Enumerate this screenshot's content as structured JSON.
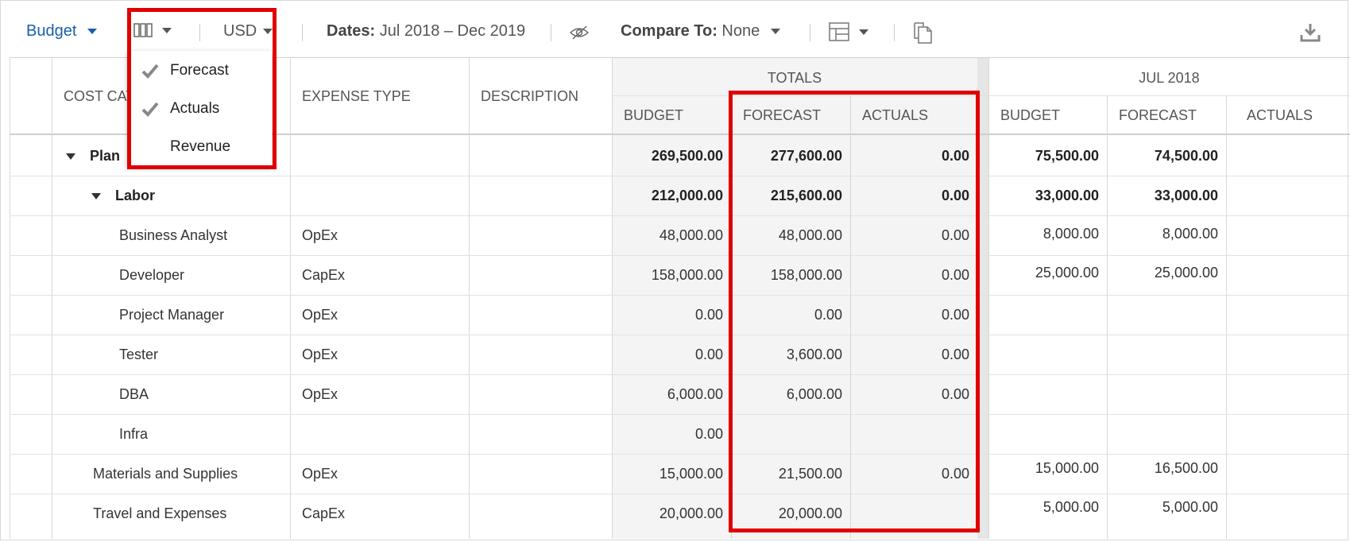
{
  "toolbar": {
    "view": "Budget",
    "currency": "USD",
    "dates_label": "Dates:",
    "dates_value": "Jul 2018 – Dec 2019",
    "compare_label": "Compare To:",
    "compare_value": "None",
    "icons": [
      "columns-icon",
      "visibility-icon",
      "table-layout-icon",
      "copy-icon",
      "download-icon"
    ]
  },
  "columns_menu": {
    "items": [
      {
        "label": "Forecast",
        "checked": true
      },
      {
        "label": "Actuals",
        "checked": true
      },
      {
        "label": "Revenue",
        "checked": false
      }
    ]
  },
  "headers": {
    "cost_category": "COST CAT",
    "expense_type": "EXPENSE TYPE",
    "description": "DESCRIPTION",
    "totals": "TOTALS",
    "jul2018": "JUL 2018",
    "budget": "BUDGET",
    "forecast": "FORECAST",
    "actuals": "ACTUALS"
  },
  "rows": [
    {
      "name": "Plan",
      "type": "",
      "t_budget": "269,500.00",
      "t_forecast": "277,600.00",
      "t_actuals": "0.00",
      "m_budget": "75,500.00",
      "m_forecast": "74,500.00"
    },
    {
      "name": "Labor",
      "type": "",
      "t_budget": "212,000.00",
      "t_forecast": "215,600.00",
      "t_actuals": "0.00",
      "m_budget": "33,000.00",
      "m_forecast": "33,000.00"
    },
    {
      "name": "Business Analyst",
      "type": "OpEx",
      "t_budget": "48,000.00",
      "t_forecast": "48,000.00",
      "t_actuals": "0.00",
      "m_budget": "8,000.00",
      "m_forecast": "8,000.00"
    },
    {
      "name": "Developer",
      "type": "CapEx",
      "t_budget": "158,000.00",
      "t_forecast": "158,000.00",
      "t_actuals": "0.00",
      "m_budget": "25,000.00",
      "m_forecast": "25,000.00"
    },
    {
      "name": "Project Manager",
      "type": "OpEx",
      "t_budget": "0.00",
      "t_forecast": "0.00",
      "t_actuals": "0.00",
      "m_budget": "",
      "m_forecast": ""
    },
    {
      "name": "Tester",
      "type": "OpEx",
      "t_budget": "0.00",
      "t_forecast": "3,600.00",
      "t_actuals": "0.00",
      "m_budget": "",
      "m_forecast": ""
    },
    {
      "name": "DBA",
      "type": "OpEx",
      "t_budget": "6,000.00",
      "t_forecast": "6,000.00",
      "t_actuals": "0.00",
      "m_budget": "",
      "m_forecast": ""
    },
    {
      "name": "Infra",
      "type": "",
      "t_budget": "0.00",
      "t_forecast": "",
      "t_actuals": "",
      "m_budget": "",
      "m_forecast": ""
    },
    {
      "name": "Materials and Supplies",
      "type": "OpEx",
      "t_budget": "15,000.00",
      "t_forecast": "21,500.00",
      "t_actuals": "0.00",
      "m_budget": "15,000.00",
      "m_forecast": "16,500.00"
    },
    {
      "name": "Travel and Expenses",
      "type": "CapEx",
      "t_budget": "20,000.00",
      "t_forecast": "20,000.00",
      "t_actuals": "",
      "m_budget": "5,000.00",
      "m_forecast": "5,000.00"
    }
  ]
}
